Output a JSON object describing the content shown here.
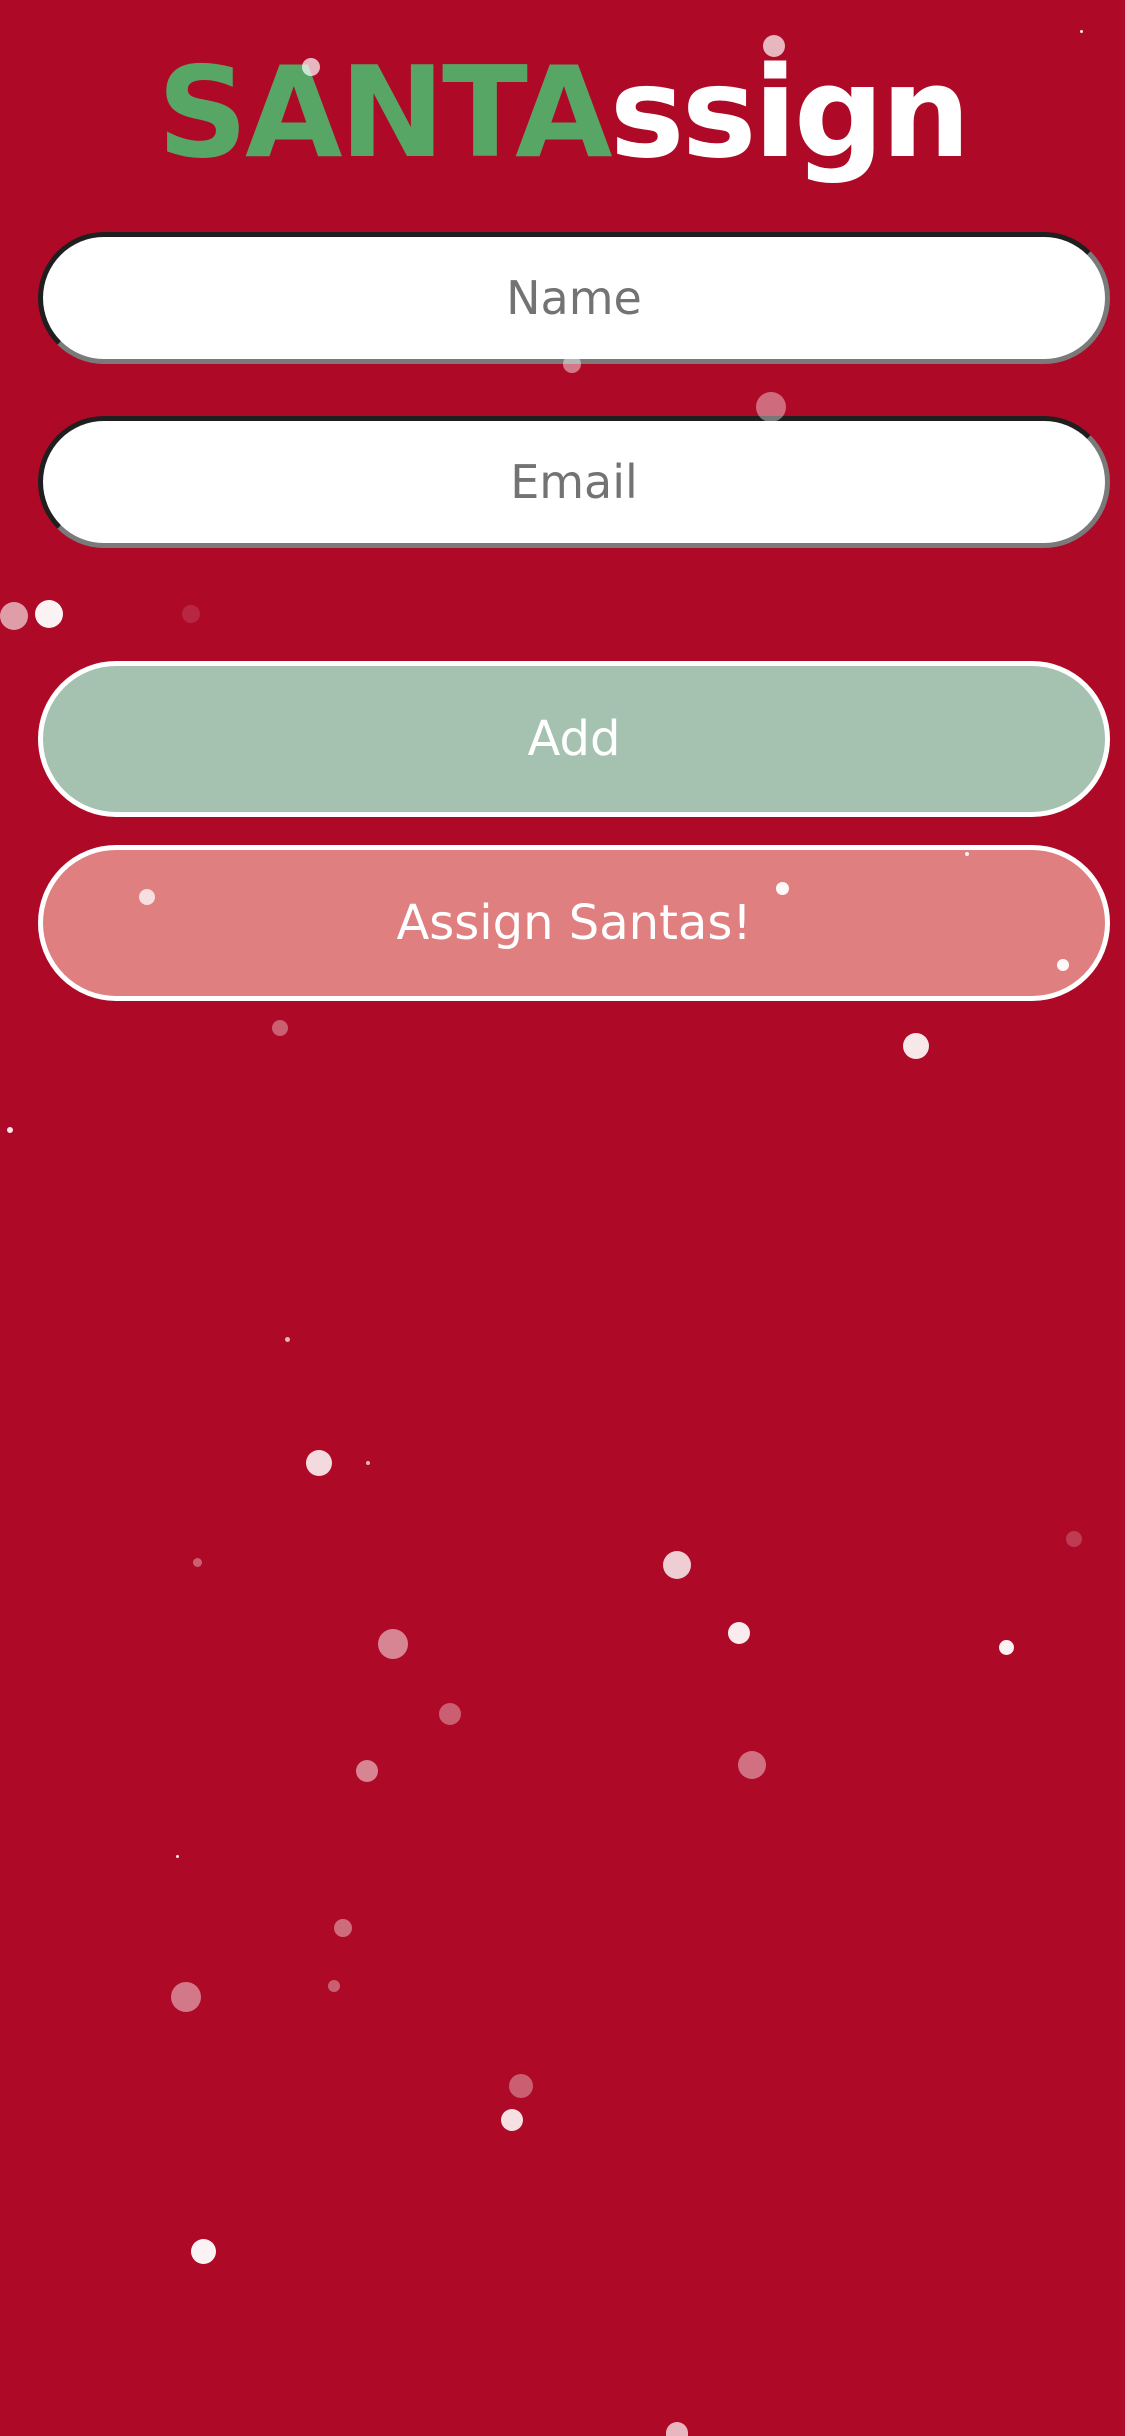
{
  "app": {
    "title_part1": "SANTA",
    "title_part2": "ssign"
  },
  "form": {
    "name_placeholder": "Name",
    "email_placeholder": "Email",
    "name_value": "",
    "email_value": ""
  },
  "actions": {
    "add_label": "Add",
    "assign_label": "Assign Santas!"
  },
  "colors": {
    "background": "#ae0a27",
    "title_green": "#57a665",
    "add_button": "#a5c1b0",
    "assign_button": "#df7f80"
  }
}
